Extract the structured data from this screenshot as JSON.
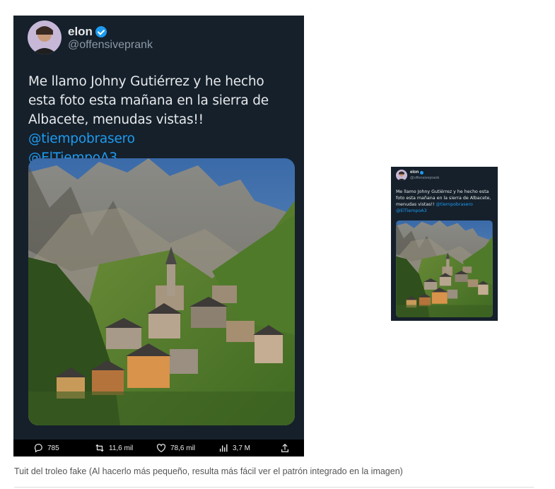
{
  "tweet": {
    "name": "elon",
    "handle": "@offensiveprank",
    "text_parts": {
      "plain": "Me llamo Johny Gutiérrez y he hecho esta foto esta mañana en la sierra de Albacete, menudas vistas!! ",
      "mention1": "@tiempobrasero",
      "mention2": "@ElTiempoA3"
    },
    "actions": {
      "replies": "785",
      "retweets": "11,6 mil",
      "likes": "78,6 mil",
      "views": "3,7 M"
    },
    "icons": [
      "verified-badge-icon",
      "reply-icon",
      "retweet-icon",
      "like-icon",
      "views-icon",
      "share-icon"
    ],
    "colors": {
      "background": "#15202b",
      "accent": "#1d9bf0",
      "text": "#e7e9ea",
      "muted": "#8b98a5"
    }
  },
  "caption": "Tuit del troleo fake (Al hacerlo más pequeño, resulta más fácil ver el patrón integrado en la imagen)"
}
